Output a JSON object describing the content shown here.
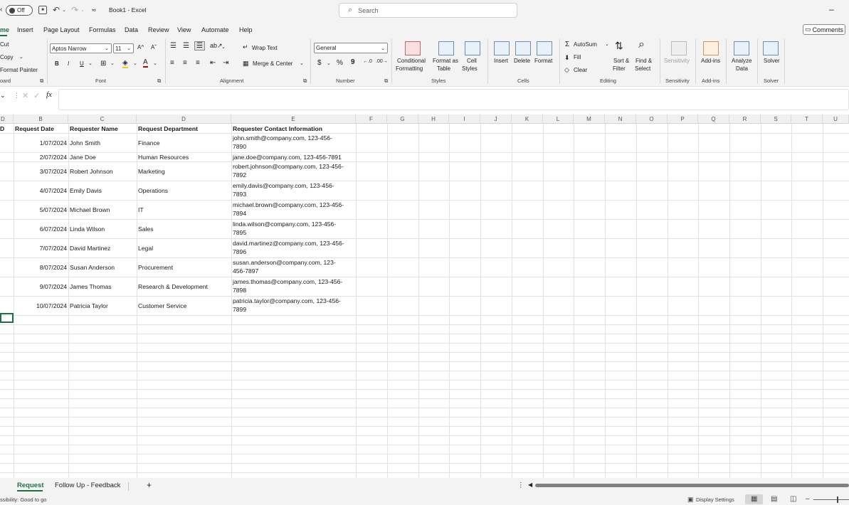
{
  "titlebar": {
    "autosave_state": "Off",
    "filename": "Book1 - Excel",
    "search_placeholder": "Search"
  },
  "menu": {
    "tabs": [
      "me",
      "Insert",
      "Page Layout",
      "Formulas",
      "Data",
      "Review",
      "View",
      "Automate",
      "Help"
    ],
    "comments": "Comments"
  },
  "ribbon": {
    "clipboard": {
      "cut": "Cut",
      "copy": "Copy",
      "format_painter": "Format Painter",
      "group": "oard"
    },
    "font": {
      "name": "Aptos Narrow",
      "size": "11",
      "bold": "B",
      "italic": "I",
      "underline": "U",
      "grow": "A^",
      "shrink": "Aˇ",
      "group": "Font"
    },
    "alignment": {
      "wrap": "Wrap Text",
      "merge": "Merge & Center",
      "group": "Alignment"
    },
    "number": {
      "format": "General",
      "currency": "$",
      "percent": "%",
      "comma": "9",
      "group": "Number"
    },
    "styles": {
      "conditional": [
        "Conditional",
        "Formatting"
      ],
      "format_table": [
        "Format as",
        "Table"
      ],
      "cell_styles": [
        "Cell",
        "Styles"
      ],
      "group": "Styles"
    },
    "cells": {
      "insert": "Insert",
      "delete": "Delete",
      "format": "Format",
      "group": "Cells"
    },
    "editing": {
      "autosum": "AutoSum",
      "fill": "Fill",
      "clear": "Clear",
      "sort": [
        "Sort &",
        "Filter"
      ],
      "find": [
        "Find &",
        "Select"
      ],
      "group": "Editing"
    },
    "sensitivity": {
      "label": "Sensitivity",
      "group": "Sensitivity"
    },
    "addins": {
      "label": "Add-ins",
      "group": "Add-ins"
    },
    "analyze": {
      "label": [
        "Analyze",
        "Data"
      ]
    },
    "solver": {
      "label": "Solver",
      "group": "Solver"
    }
  },
  "formula_bar": {
    "fx": "fx",
    "value": ""
  },
  "columns": [
    "D",
    "B",
    "C",
    "D",
    "E",
    "F",
    "G",
    "H",
    "I",
    "J",
    "K",
    "L",
    "M",
    "N",
    "O",
    "P",
    "Q",
    "R",
    "S",
    "T",
    "U"
  ],
  "table": {
    "headers": [
      "D",
      "Request Date",
      "Requester Name",
      "Request Department",
      "Requester Contact Information"
    ],
    "rows": [
      {
        "date": "1/07/2024",
        "name": "John Smith",
        "dept": "Finance",
        "contact1": "john.smith@company.com, 123-456-",
        "contact2": "7890"
      },
      {
        "date": "2/07/2024",
        "name": "Jane Doe",
        "dept": "Human Resources",
        "contact1": "jane.doe@company.com, 123-456-7891",
        "contact2": ""
      },
      {
        "date": "3/07/2024",
        "name": "Robert Johnson",
        "dept": "Marketing",
        "contact1": "robert.johnson@company.com, 123-456-",
        "contact2": "7892"
      },
      {
        "date": "4/07/2024",
        "name": "Emily Davis",
        "dept": "Operations",
        "contact1": "emily.davis@company.com, 123-456-",
        "contact2": "7893"
      },
      {
        "date": "5/07/2024",
        "name": "Michael Brown",
        "dept": "IT",
        "contact1": "michael.brown@company.com, 123-456-",
        "contact2": "7894"
      },
      {
        "date": "6/07/2024",
        "name": "Linda Wilson",
        "dept": "Sales",
        "contact1": "linda.wilson@company.com, 123-456-",
        "contact2": "7895"
      },
      {
        "date": "7/07/2024",
        "name": "David Martinez",
        "dept": "Legal",
        "contact1": "david.martinez@company.com, 123-456-",
        "contact2": "7896"
      },
      {
        "date": "8/07/2024",
        "name": "Susan Anderson",
        "dept": "Procurement",
        "contact1": "susan.anderson@company.com, 123-",
        "contact2": "456-7897"
      },
      {
        "date": "9/07/2024",
        "name": "James Thomas",
        "dept": "Research & Development",
        "contact1": "james.thomas@company.com, 123-456-",
        "contact2": "7898"
      },
      {
        "date": "10/07/2024",
        "name": "Patricia Taylor",
        "dept": "Customer Service",
        "contact1": "patricia.taylor@company.com, 123-456-",
        "contact2": "7899"
      }
    ]
  },
  "sheets": {
    "tabs": [
      "Request",
      "Follow Up - Feedback"
    ],
    "add": "+",
    "dots": "⋮"
  },
  "status": {
    "accessibility": "ssibility: Good to go",
    "display_settings": "Display Settings",
    "zoom_minus": "–"
  },
  "colors": {
    "accent": "#1e7145",
    "ribbon_bg": "#f3f3f3"
  }
}
